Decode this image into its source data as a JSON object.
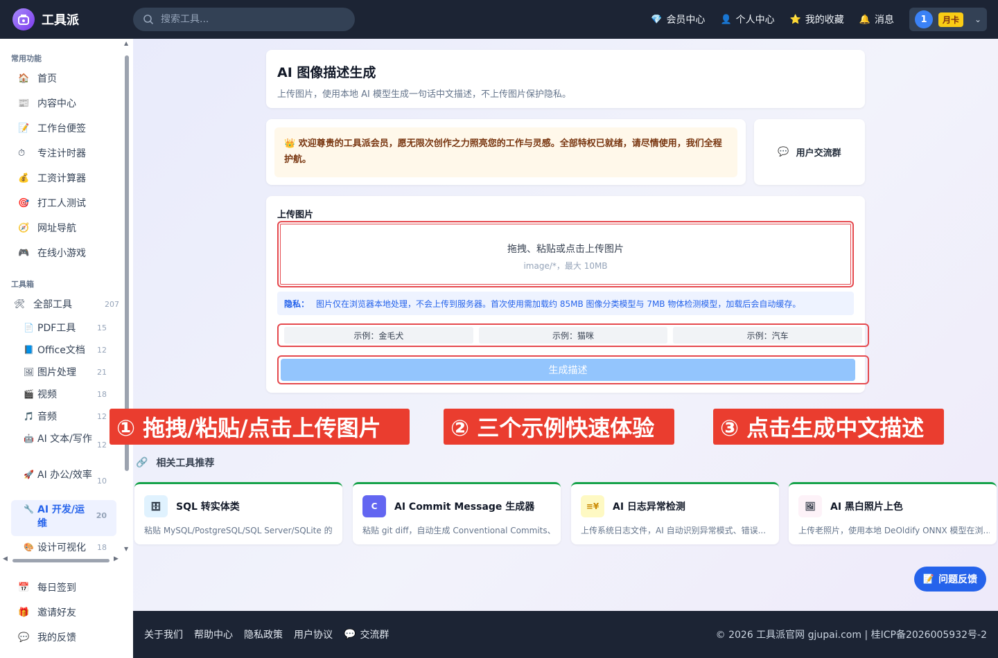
{
  "app": {
    "title": "工具派"
  },
  "search": {
    "placeholder": "搜索工具..."
  },
  "top_nav": [
    {
      "label": "会员中心",
      "icon": "diamond-icon",
      "glyph": "💎"
    },
    {
      "label": "个人中心",
      "icon": "person-icon",
      "glyph": "👤"
    },
    {
      "label": "我的收藏",
      "icon": "star-icon",
      "glyph": "⭐"
    },
    {
      "label": "消息",
      "icon": "bell-icon",
      "glyph": "🔔"
    }
  ],
  "user": {
    "avatar_text": "1",
    "plan_badge": "月卡"
  },
  "sidebar": {
    "common_title": "常用功能",
    "common_items": [
      {
        "label": "首页",
        "glyph": "🏠"
      },
      {
        "label": "内容中心",
        "glyph": "📰"
      },
      {
        "label": "工作台便签",
        "glyph": "📝"
      },
      {
        "label": "专注计时器",
        "glyph": "⏱"
      },
      {
        "label": "工资计算器",
        "glyph": "💰"
      },
      {
        "label": "打工人测试",
        "glyph": "🎯"
      },
      {
        "label": "网址导航",
        "glyph": "🧭"
      },
      {
        "label": "在线小游戏",
        "glyph": "🎮"
      }
    ],
    "toolbox_title": "工具箱",
    "all_tools": {
      "label": "全部工具",
      "count": "207",
      "glyph": "🛠"
    },
    "categories": [
      {
        "label": "PDF工具",
        "count": "15",
        "glyph": "📄"
      },
      {
        "label": "Office文档",
        "count": "12",
        "glyph": "📘"
      },
      {
        "label": "图片处理",
        "count": "21",
        "glyph": "🖼"
      },
      {
        "label": "视频",
        "count": "18",
        "glyph": "🎬"
      },
      {
        "label": "音频",
        "count": "12",
        "glyph": "🎵"
      },
      {
        "label": "AI 文本/写作",
        "count": "12",
        "glyph": "🤖"
      },
      {
        "label": "AI 办公/效率",
        "count": "10",
        "glyph": "🚀"
      },
      {
        "label": "AI 开发/运维",
        "count": "20",
        "glyph": "🔧"
      },
      {
        "label": "设计可视化",
        "count": "18",
        "glyph": "🎨"
      }
    ],
    "bottom_items": [
      {
        "label": "每日签到",
        "glyph": "📅"
      },
      {
        "label": "邀请好友",
        "glyph": "🎁"
      },
      {
        "label": "我的反馈",
        "glyph": "💬"
      }
    ]
  },
  "header_card": {
    "title": "AI 图像描述生成",
    "subtitle": "上传图片，使用本地 AI 模型生成一句话中文描述，不上传图片保护隐私。"
  },
  "welcome": {
    "glyph": "👑",
    "text": "欢迎尊贵的工具派会员，愿无限次创作之力照亮您的工作与灵感。全部特权已就绪，请尽情使用，我们全程护航。"
  },
  "group_button": {
    "label": "用户交流群",
    "glyph": "💬"
  },
  "upload": {
    "section_label": "上传图片",
    "dropzone_text": "拖拽、粘贴或点击上传图片",
    "dropzone_hint": "image/*，最大 10MB",
    "privacy_label": "隐私：",
    "privacy_text": "图片仅在浏览器本地处理，不会上传到服务器。首次使用需加载约 85MB 图像分类模型与 7MB 物体检测模型，加载后会自动缓存。",
    "examples": [
      "示例：金毛犬",
      "示例：猫咪",
      "示例：汽车"
    ],
    "generate_label": "生成描述"
  },
  "callouts": [
    "① 拖拽/粘贴/点击上传图片",
    "② 三个示例快速体验",
    "③ 点击生成中文描述"
  ],
  "related": {
    "title": "相关工具推荐",
    "tools": [
      {
        "name": "SQL 转实体类",
        "desc": "粘贴 MySQL/PostgreSQL/SQL Server/SQLite 的 CR...",
        "icon": "database-icon",
        "glyph": "🗄",
        "icon_bg": "#e0f2fe"
      },
      {
        "name": "AI Commit Message 生成器",
        "desc": "粘贴 git diff，自动生成 Conventional Commits、...",
        "icon": "code-icon",
        "glyph": "C",
        "icon_bg": "#6366f1"
      },
      {
        "name": "AI 日志异常检测",
        "desc": "上传系统日志文件，AI 自动识别异常模式、错误...",
        "icon": "log-icon",
        "glyph": "≡¥",
        "icon_bg": "#fef9c3"
      },
      {
        "name": "AI 黑白照片上色",
        "desc": "上传老照片，使用本地 DeOldify ONNX 模型在浏...",
        "icon": "image-icon",
        "glyph": "🖼",
        "icon_bg": "#fdf2f8"
      }
    ]
  },
  "feedback": {
    "label": "问题反馈",
    "glyph": "📝"
  },
  "footer": {
    "links": [
      "关于我们",
      "帮助中心",
      "隐私政策",
      "用户协议"
    ],
    "group_label": "交流群",
    "copyright": "© 2026 工具派官网 gjupai.com | 桂ICP备2026005932号-2"
  },
  "colors": {
    "accent": "#2563eb",
    "topbar": "#1c2434",
    "callout": "#ea3d2f",
    "highlight_border": "#e5484d"
  }
}
